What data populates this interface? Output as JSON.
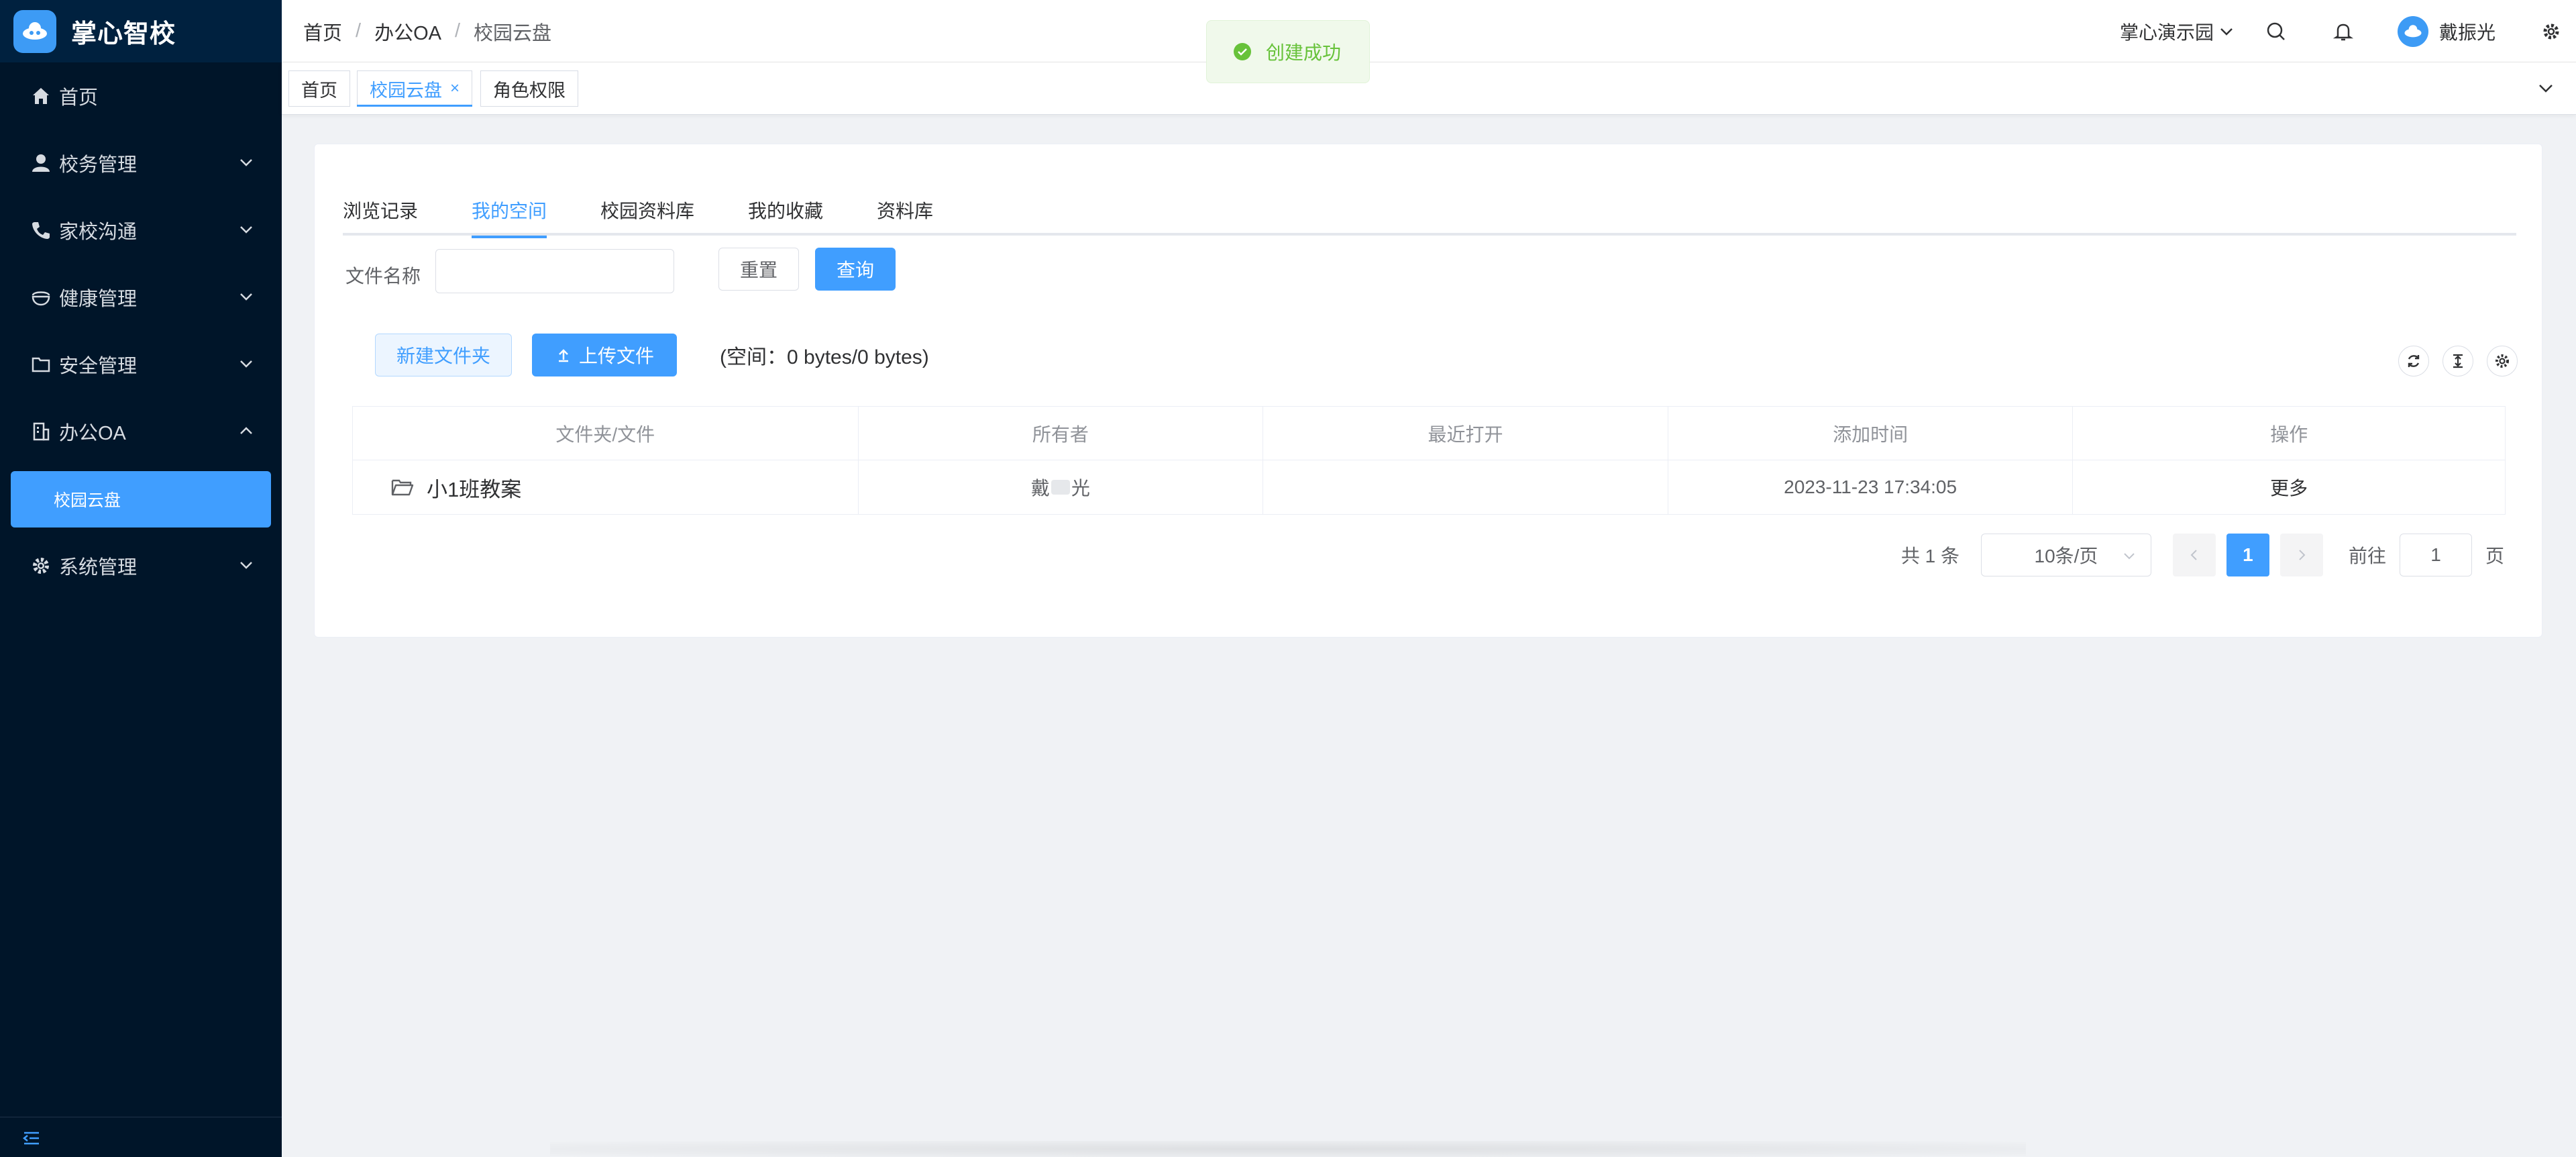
{
  "app": {
    "title": "掌心智校"
  },
  "sidebar": {
    "items": [
      {
        "label": "首页"
      },
      {
        "label": "校务管理"
      },
      {
        "label": "家校沟通"
      },
      {
        "label": "健康管理"
      },
      {
        "label": "安全管理"
      },
      {
        "label": "办公OA"
      },
      {
        "label": "系统管理"
      }
    ],
    "subitem": {
      "label": "校园云盘"
    }
  },
  "header": {
    "breadcrumb": [
      "首页",
      "办公OA",
      "校园云盘"
    ],
    "campus": "掌心演示园",
    "user": "戴振光"
  },
  "tags": [
    {
      "label": "首页"
    },
    {
      "label": "校园云盘",
      "close": "×"
    },
    {
      "label": "角色权限"
    }
  ],
  "toast": {
    "text": "创建成功"
  },
  "tabs": [
    "浏览记录",
    "我的空间",
    "校园资料库",
    "我的收藏",
    "资料库"
  ],
  "filter": {
    "label": "文件名称",
    "value": "",
    "reset": "重置",
    "query": "查询"
  },
  "actions": {
    "new_folder": "新建文件夹",
    "upload": "上传文件",
    "space": "(空间：0 bytes/0 bytes)"
  },
  "table": {
    "headers": [
      "文件夹/文件",
      "所有者",
      "最近打开",
      "添加时间",
      "操作"
    ],
    "rows": [
      {
        "name": "小1班教案",
        "owner_first": "戴",
        "owner_last": "光",
        "opened": "",
        "added": "2023-11-23 17:34:05",
        "action": "更多"
      }
    ]
  },
  "pagination": {
    "total": "共 1 条",
    "page_size": "10条/页",
    "current": "1",
    "goto": "前往",
    "jump_value": "1",
    "page_unit": "页"
  },
  "colors": {
    "primary": "#409eff",
    "sidebar": "#001529",
    "success": "#67c23a"
  }
}
